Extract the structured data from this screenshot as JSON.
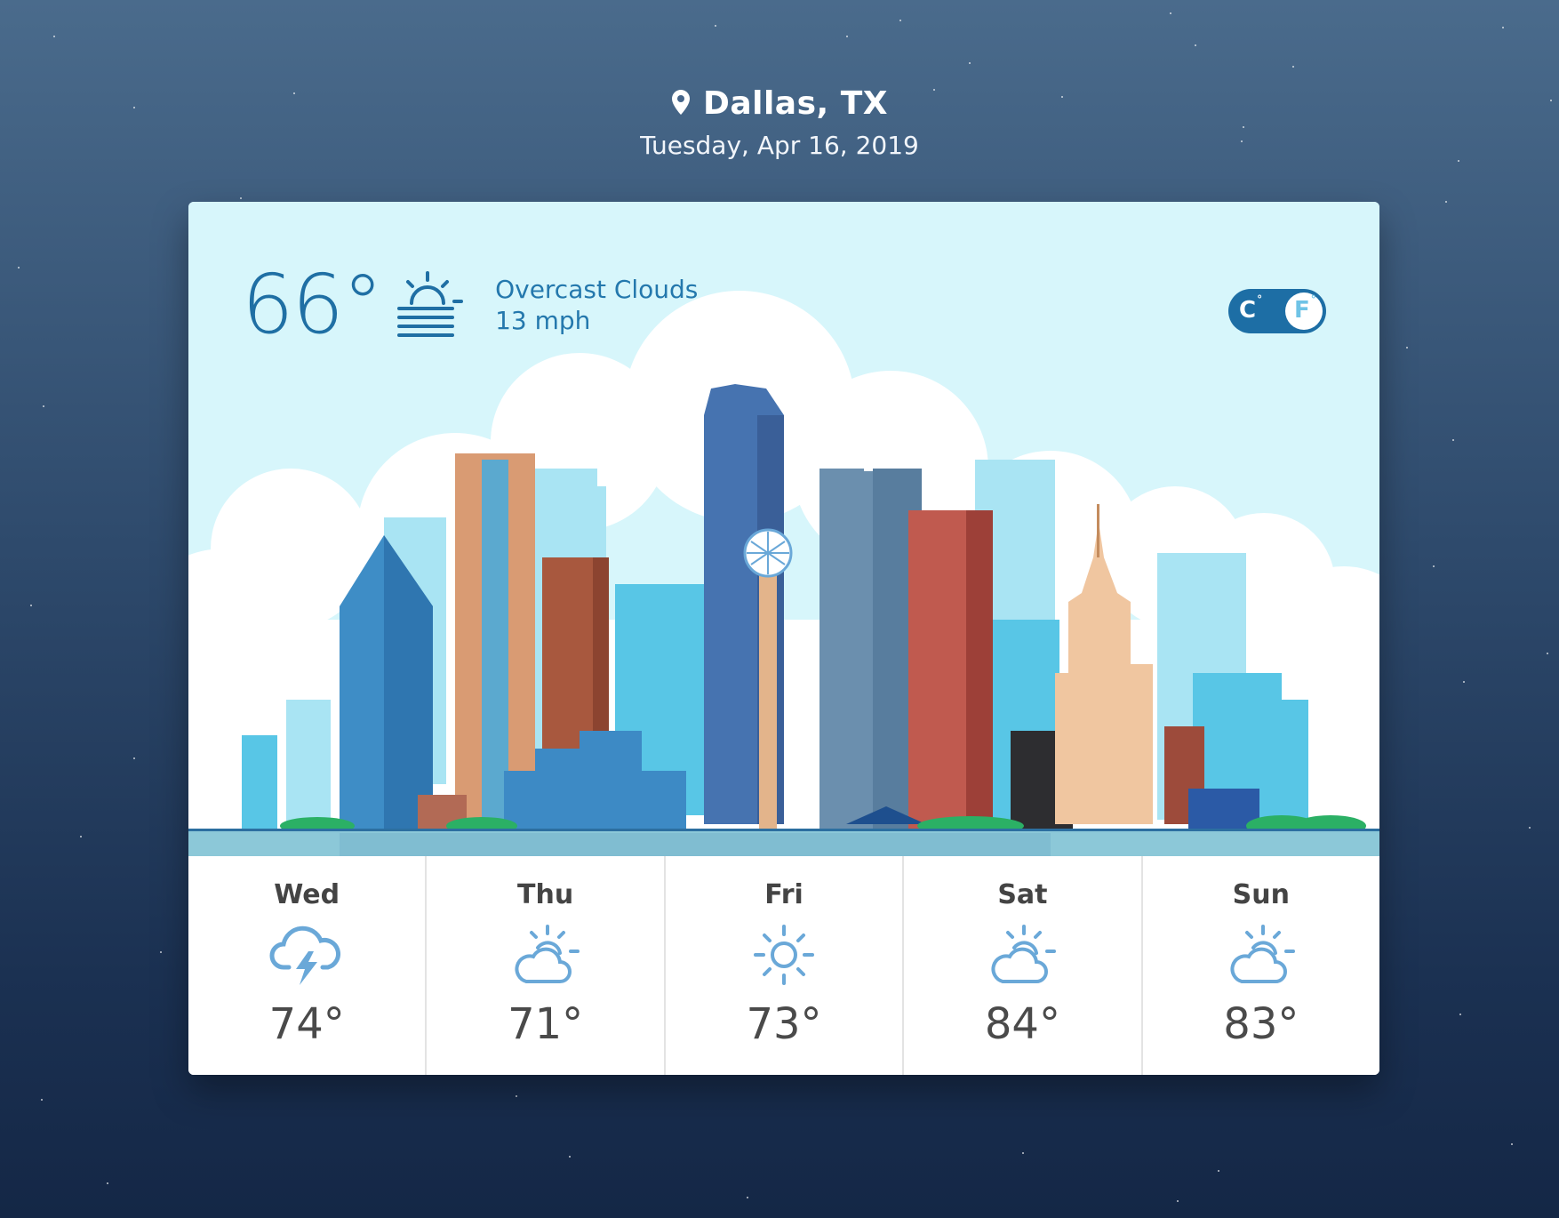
{
  "location": {
    "icon": "map-pin-icon",
    "city": "Dallas, TX",
    "date": "Tuesday, Apr 16, 2019"
  },
  "current": {
    "temperature": "66°",
    "condition_icon": "fog-sun-icon",
    "condition": "Overcast Clouds",
    "wind": "13 mph"
  },
  "unit_toggle": {
    "celsius_label": "C",
    "fahrenheit_label": "F",
    "selected": "F"
  },
  "forecast": [
    {
      "day": "Wed",
      "icon": "thunderstorm-icon",
      "temp": "74°"
    },
    {
      "day": "Thu",
      "icon": "partly-cloudy-icon",
      "temp": "71°"
    },
    {
      "day": "Fri",
      "icon": "sun-icon",
      "temp": "73°"
    },
    {
      "day": "Sat",
      "icon": "partly-cloudy-icon",
      "temp": "84°"
    },
    {
      "day": "Sun",
      "icon": "partly-cloudy-icon",
      "temp": "83°"
    }
  ],
  "colors": {
    "accent": "#1f6fa4",
    "toggle": "#1d6ea5",
    "icon_blue": "#6aa8d8",
    "sky": "#d7f6fb"
  }
}
